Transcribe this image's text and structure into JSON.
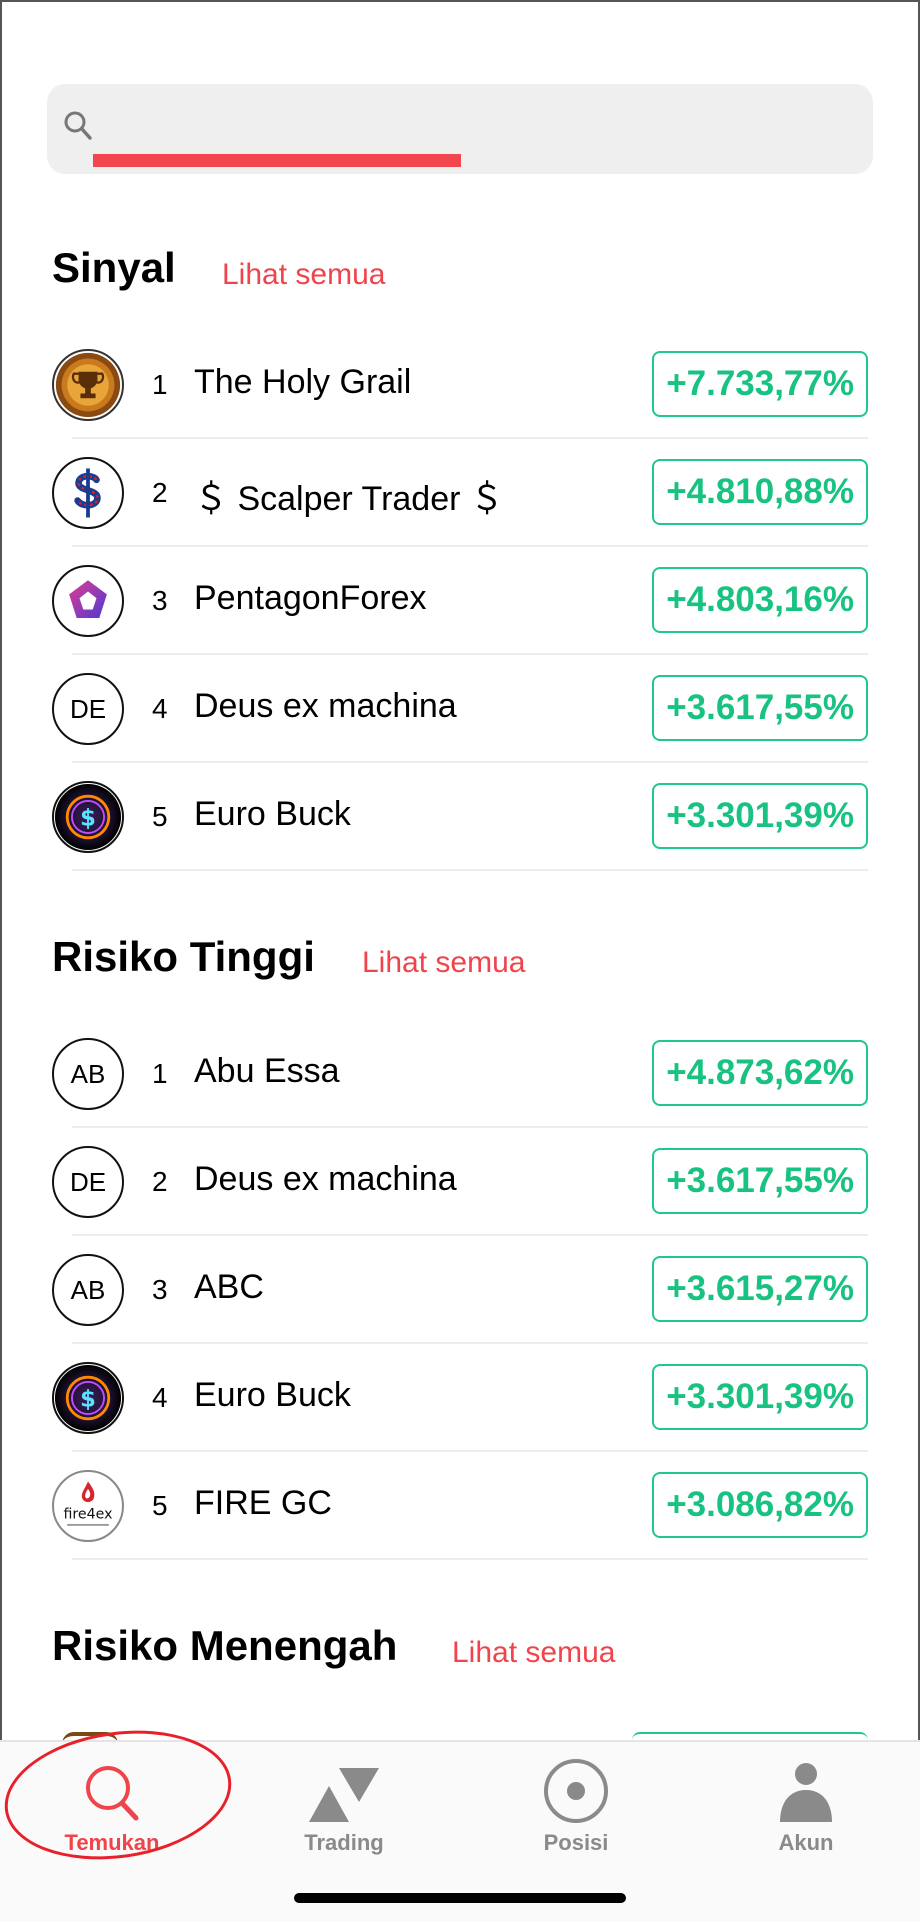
{
  "search": {
    "placeholder": "",
    "value": ""
  },
  "sections": [
    {
      "title": "Sinyal",
      "see_all": "Lihat semua",
      "items": [
        {
          "rank": "1",
          "name": "The Holy Grail",
          "pct": "+7.733,77%",
          "avatar": "trophy-avatar-icon",
          "initials": ""
        },
        {
          "rank": "2",
          "name": "＄ Scalper Trader ＄",
          "pct": "+4.810,88%",
          "avatar": "dollar-avatar-icon",
          "initials": ""
        },
        {
          "rank": "3",
          "name": "PentagonForex",
          "pct": "+4.803,16%",
          "avatar": "pentagon-avatar-icon",
          "initials": ""
        },
        {
          "rank": "4",
          "name": "Deus ex machina",
          "pct": "+3.617,55%",
          "avatar": "initials",
          "initials": "DE"
        },
        {
          "rank": "5",
          "name": "Euro Buck",
          "pct": "+3.301,39%",
          "avatar": "euro-buck-avatar-icon",
          "initials": ""
        }
      ]
    },
    {
      "title": "Risiko Tinggi",
      "see_all": "Lihat semua",
      "items": [
        {
          "rank": "1",
          "name": "Abu Essa",
          "pct": "+4.873,62%",
          "avatar": "initials",
          "initials": "AB"
        },
        {
          "rank": "2",
          "name": "Deus ex machina",
          "pct": "+3.617,55%",
          "avatar": "initials",
          "initials": "DE"
        },
        {
          "rank": "3",
          "name": "ABC",
          "pct": "+3.615,27%",
          "avatar": "initials",
          "initials": "AB"
        },
        {
          "rank": "4",
          "name": "Euro Buck",
          "pct": "+3.301,39%",
          "avatar": "euro-buck-avatar-icon",
          "initials": ""
        },
        {
          "rank": "5",
          "name": "FIRE GC",
          "pct": "+3.086,82%",
          "avatar": "fire4ex-logo-icon",
          "initials": ""
        }
      ]
    },
    {
      "title": "Risiko Menengah",
      "see_all": "Lihat semua",
      "items": []
    }
  ],
  "logo_text": {
    "fire4ex": "fire4ex"
  },
  "nav": [
    {
      "label": "Temukan",
      "icon": "search-icon",
      "active": true
    },
    {
      "label": "Trading",
      "icon": "trading-icon",
      "active": false
    },
    {
      "label": "Posisi",
      "icon": "posisi-icon",
      "active": false
    },
    {
      "label": "Akun",
      "icon": "account-icon",
      "active": false
    }
  ],
  "colors": {
    "accent": "#f0444c",
    "positive": "#18c280",
    "annotation": "#e8202a"
  }
}
